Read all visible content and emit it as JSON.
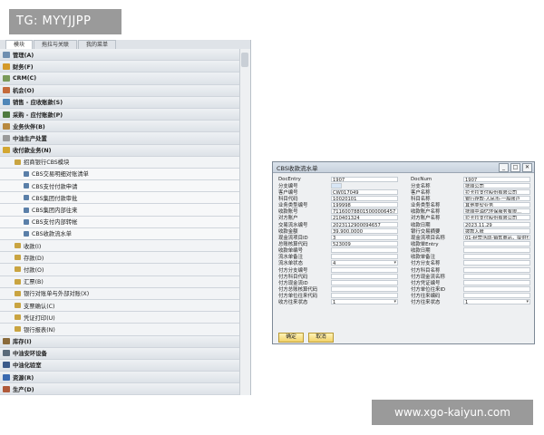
{
  "watermarks": {
    "top": "TG: MYYJJPP",
    "bottom": "www.xgo-kaiyun.com"
  },
  "tabs": [
    "模块",
    "拖拉与关联",
    "我的菜单"
  ],
  "tree": [
    {
      "label": "管理(A)",
      "level": 0,
      "icon": "admin-icon",
      "color": "#6f8fb0"
    },
    {
      "label": "财务(F)",
      "level": 0,
      "icon": "finance-icon",
      "color": "#d49a2a"
    },
    {
      "label": "CRM(C)",
      "level": 0,
      "icon": "crm-icon",
      "color": "#7a9a5a"
    },
    {
      "label": "机会(O)",
      "level": 0,
      "icon": "opportunity-icon",
      "color": "#c46a3a"
    },
    {
      "label": "销售 - 应收账款(S)",
      "level": 0,
      "icon": "sales-icon",
      "color": "#4f86b8"
    },
    {
      "label": "采购 - 应付账款(P)",
      "level": 0,
      "icon": "purchase-icon",
      "color": "#4f7a3f"
    },
    {
      "label": "业务伙伴(B)",
      "level": 0,
      "icon": "partner-icon",
      "color": "#b8893f"
    },
    {
      "label": "中油生产处置",
      "level": 0,
      "icon": "production-icon",
      "color": "#9a9a9a"
    },
    {
      "label": "收付款业务(N)",
      "level": 0,
      "icon": "payment-icon",
      "color": "#d3a630"
    },
    {
      "label": "招商银行CBS模块",
      "level": 1,
      "icon": "folder-icon"
    },
    {
      "label": "CBS交易明细对账清单",
      "level": 2,
      "icon": "document-icon"
    },
    {
      "label": "CBS支付付款申请",
      "level": 2,
      "icon": "document-icon"
    },
    {
      "label": "CBS集团付款审批",
      "level": 2,
      "icon": "document-icon"
    },
    {
      "label": "CBS集团内部往来",
      "level": 2,
      "icon": "document-icon"
    },
    {
      "label": "CBS支付内部转帐",
      "level": 2,
      "icon": "document-icon"
    },
    {
      "label": "CBS收款流水单",
      "level": 2,
      "icon": "document-icon"
    },
    {
      "label": "收款(I)",
      "level": 1,
      "icon": "folder-icon"
    },
    {
      "label": "存款(D)",
      "level": 1,
      "icon": "folder-icon"
    },
    {
      "label": "付款(O)",
      "level": 1,
      "icon": "folder-icon"
    },
    {
      "label": "汇票(B)",
      "level": 1,
      "icon": "folder-icon"
    },
    {
      "label": "银行对账单与外部对账(X)",
      "level": 1,
      "icon": "folder-icon"
    },
    {
      "label": "支票确认(C)",
      "level": 1,
      "icon": "folder-icon"
    },
    {
      "label": "凭证打印(U)",
      "level": 1,
      "icon": "folder-icon"
    },
    {
      "label": "银行报表(N)",
      "level": 1,
      "icon": "folder-icon"
    },
    {
      "label": "库存(I)",
      "level": 0,
      "icon": "inventory-icon",
      "color": "#8a6a3a"
    },
    {
      "label": "中油安环设备",
      "level": 0,
      "icon": "equipment-icon",
      "color": "#5a6a7a"
    },
    {
      "label": "中油化验室",
      "level": 0,
      "icon": "lab-icon",
      "color": "#3a5a8a"
    },
    {
      "label": "资源(R)",
      "level": 0,
      "icon": "resource-icon",
      "color": "#3a6ab0"
    },
    {
      "label": "生产(D)",
      "level": 0,
      "icon": "production2-icon",
      "color": "#b05a3a"
    }
  ],
  "dialog": {
    "title": "CBS收款流水单",
    "controls": [
      "_",
      "□",
      "✕"
    ],
    "left": [
      {
        "label": "DocEntry",
        "value": "1907"
      },
      {
        "label": "分支编号",
        "value": "",
        "mark": true
      },
      {
        "label": "客户编号",
        "value": "CW017049"
      },
      {
        "label": "科目代码",
        "value": "10020101"
      },
      {
        "label": "业务类型编号",
        "value": "199998"
      },
      {
        "label": "收款账号",
        "value": "711600788015000006457"
      },
      {
        "label": "对方账户",
        "value": "210401324"
      },
      {
        "label": "交易流水编号",
        "value": "2023112900094657"
      },
      {
        "label": "收款金额",
        "value": "39,900.0000"
      },
      {
        "label": "现金流项目ID",
        "value": "3"
      },
      {
        "label": "总账核算代码",
        "value": "523009"
      },
      {
        "label": "收款单编号",
        "value": ""
      },
      {
        "label": "流水单备注",
        "value": ""
      },
      {
        "label": "流水单状态",
        "value": "4",
        "dropdown": true
      },
      {
        "label": "付方分支编号",
        "value": ""
      },
      {
        "label": "付方科目代码",
        "value": ""
      },
      {
        "label": "付方现金流ID",
        "value": ""
      },
      {
        "label": "付方总账核算代码",
        "value": ""
      },
      {
        "label": "付方单位往来代码",
        "value": ""
      },
      {
        "label": "收方往来状态",
        "value": "1",
        "dropdown": true
      }
    ],
    "right": [
      {
        "label": "DocNum",
        "value": "1907"
      },
      {
        "label": "分支名称",
        "value": "抚顺公司"
      },
      {
        "label": "客户名称",
        "value": "拉卡拉支付股份有限公司"
      },
      {
        "label": "科目名称",
        "value": "银行存款-人民币-一般账户"
      },
      {
        "label": "业务类型名称",
        "value": "其他类型业务"
      },
      {
        "label": "收款账户名称",
        "value": "抚顺中油忆环保服务有限..."
      },
      {
        "label": "对方账户名称",
        "value": "拉卡拉支付股份有限公司"
      },
      {
        "label": "收款日期",
        "value": "2023.11.29"
      },
      {
        "label": "银行交易摘要",
        "value": "拨款入账"
      },
      {
        "label": "现金流项目名称",
        "value": "01-经营活动-销售商品，提供...",
        "dropdown": true
      },
      {
        "label": "收款单Entry",
        "value": ""
      },
      {
        "label": "收款日期",
        "value": ""
      },
      {
        "label": "收款单备注",
        "value": ""
      },
      {
        "label": "付方分支名称",
        "value": ""
      },
      {
        "label": "付方科目名称",
        "value": ""
      },
      {
        "label": "付方现金流名称",
        "value": ""
      },
      {
        "label": "付方凭证编号",
        "value": ""
      },
      {
        "label": "付方单位往来ID",
        "value": ""
      },
      {
        "label": "付方往来编码",
        "value": ""
      },
      {
        "label": "付方往来状态",
        "value": "1",
        "dropdown": true
      }
    ],
    "buttons": {
      "ok": "确定",
      "cancel": "取消"
    }
  }
}
